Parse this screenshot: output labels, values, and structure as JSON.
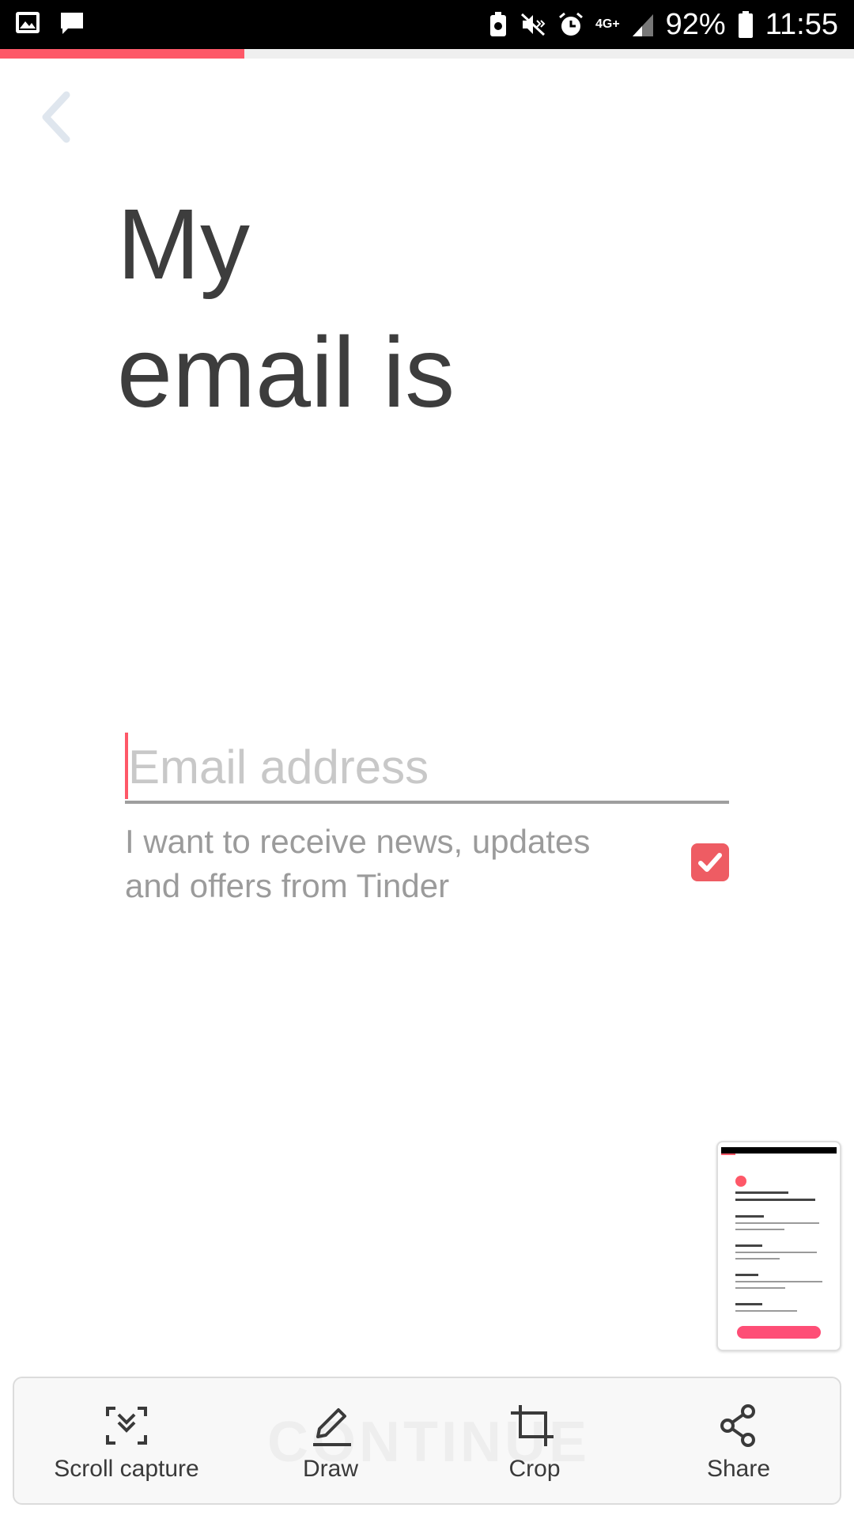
{
  "status_bar": {
    "network": "4G+",
    "battery": "92%",
    "time": "11:55"
  },
  "onboarding": {
    "progress": 0.286,
    "title_line1": "My",
    "title_line2": "email is",
    "email": {
      "value": "",
      "placeholder": "Email address"
    },
    "optin": {
      "text": "I want to receive news, updates and offers from Tinder",
      "checked": true
    }
  },
  "toolbar": {
    "background_button_label": "CONTINUE",
    "items": [
      {
        "label": "Scroll capture",
        "icon": "scroll-capture-icon"
      },
      {
        "label": "Draw",
        "icon": "pen-icon"
      },
      {
        "label": "Crop",
        "icon": "crop-icon"
      },
      {
        "label": "Share",
        "icon": "share-icon"
      }
    ]
  },
  "colors": {
    "accent": "#fe5868",
    "checkbox": "#ee5c63",
    "title": "#3d3d3d",
    "secondary_text": "#9b9b9b"
  }
}
